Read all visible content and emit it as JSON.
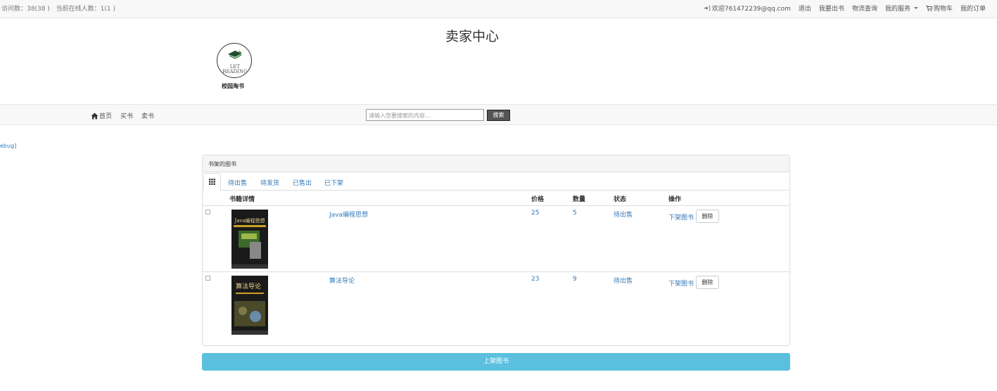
{
  "topbar": {
    "visits_label": "访问数：38(38 )",
    "online_label": "当前在线人数：1(1 )",
    "welcome": "欢迎761472239@qq.com",
    "logout": "退出",
    "sell_book": "我要出书",
    "logistics": "物流查询",
    "my_services": "我的服务",
    "cart": "购物车",
    "my_orders": "我的订单"
  },
  "header": {
    "title": "卖家中心",
    "logo_text_1": "LET",
    "logo_text_2": "READING",
    "logo_caption": "校园淘书"
  },
  "nav": {
    "home": "首页",
    "buy": "买书",
    "sell": "卖书",
    "search_placeholder": "请输入您要搜索的内容...",
    "search_button": "搜索"
  },
  "debug_text": "ebug]",
  "panel": {
    "title": "书架的图书",
    "tabs": [
      "待出售",
      "待发货",
      "已售出",
      "已下架"
    ],
    "columns": {
      "details": "书籍详情",
      "price": "价格",
      "quantity": "数量",
      "status": "状态",
      "actions": "操作"
    },
    "books": [
      {
        "title": "Java编程思想",
        "price": "25",
        "quantity": "5",
        "status": "待出售",
        "unlist": "下架图书",
        "delete": "删除",
        "cover_text": "Java编程思想"
      },
      {
        "title": "算法导论",
        "price": "23",
        "quantity": "9",
        "status": "待出售",
        "unlist": "下架图书",
        "delete": "删除",
        "cover_text": "算法导论"
      }
    ]
  },
  "submit_button": "上架图书"
}
